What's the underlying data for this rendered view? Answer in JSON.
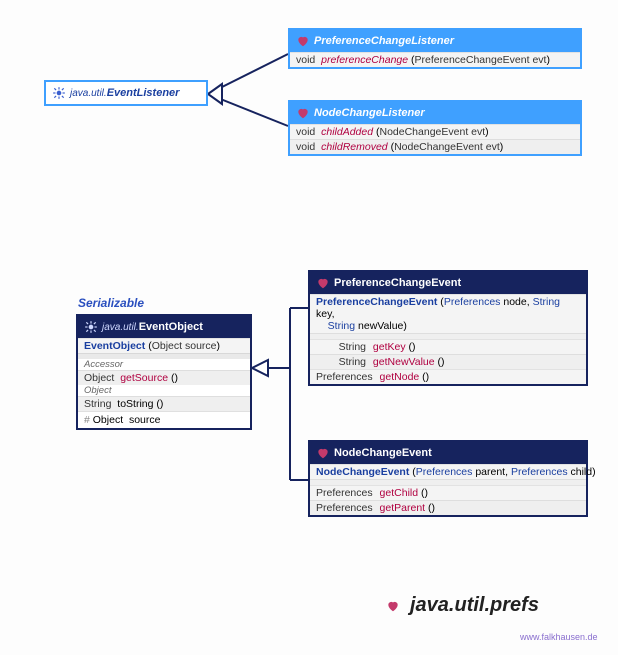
{
  "connectors": {
    "stroke": "#16235e"
  },
  "package_title": {
    "heart_fill": "#c43a6b",
    "text": "java.util.prefs"
  },
  "credit": "www.falkhausen.de",
  "serializable_label": "Serializable",
  "event_listener": {
    "pkg": "java.util.",
    "name": "EventListener"
  },
  "event_object": {
    "pkg": "java.util.",
    "name": "EventObject",
    "ctor_name": "EventObject",
    "ctor_param_type": "Object",
    "ctor_param_name": "source",
    "accessor_label": "Accessor",
    "m1_ret": "Object",
    "m1_name": "getSource",
    "object_label": "Object",
    "m2_ret": "String",
    "m2_name": "toString",
    "field_vis": "#",
    "field_type": "Object",
    "field_name": "source"
  },
  "pref_change_listener": {
    "name": "PreferenceChangeListener",
    "m1_ret": "void",
    "m1_name": "preferenceChange",
    "m1_ptype": "PreferenceChangeEvent",
    "m1_pname": "evt"
  },
  "node_change_listener": {
    "name": "NodeChangeListener",
    "m1_ret": "void",
    "m1_name": "childAdded",
    "m1_ptype": "NodeChangeEvent",
    "m1_pname": "evt",
    "m2_ret": "void",
    "m2_name": "childRemoved",
    "m2_ptype": "NodeChangeEvent",
    "m2_pname": "evt"
  },
  "pref_change_event": {
    "name": "PreferenceChangeEvent",
    "ctor_name": "PreferenceChangeEvent",
    "ctor_p1_type": "Preferences",
    "ctor_p1_name": "node",
    "ctor_p2_type": "String",
    "ctor_p2_name": "key",
    "ctor_p3_type": "String",
    "ctor_p3_name": "newValue",
    "m1_ret": "String",
    "m1_name": "getKey",
    "m2_ret": "String",
    "m2_name": "getNewValue",
    "m3_ret": "Preferences",
    "m3_name": "getNode"
  },
  "node_change_event": {
    "name": "NodeChangeEvent",
    "ctor_name": "NodeChangeEvent",
    "ctor_p1_type": "Preferences",
    "ctor_p1_name": "parent",
    "ctor_p2_type": "Preferences",
    "ctor_p2_name": "child",
    "m1_ret": "Preferences",
    "m1_name": "getChild",
    "m2_ret": "Preferences",
    "m2_name": "getParent"
  }
}
